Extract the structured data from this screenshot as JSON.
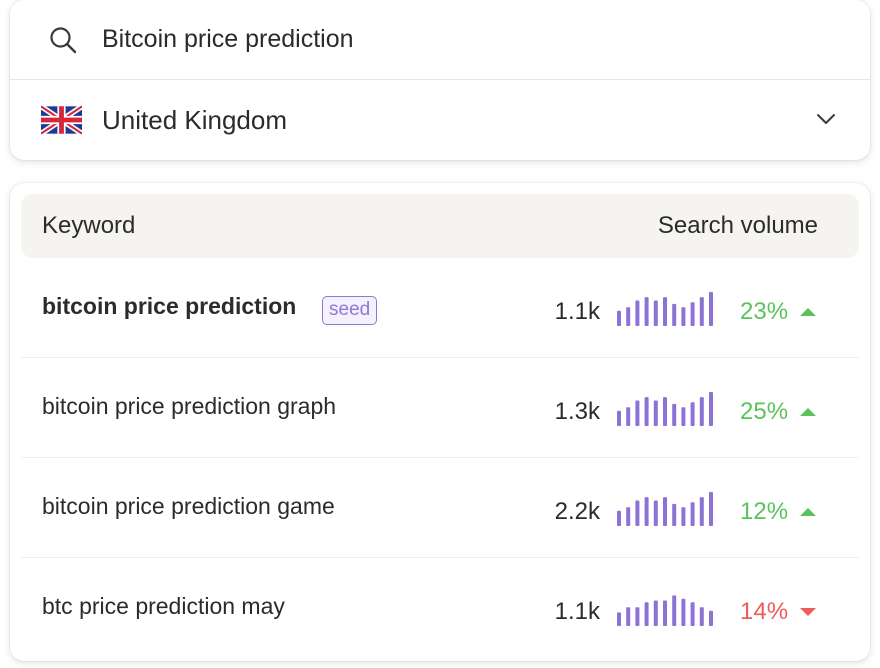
{
  "search": {
    "query": "Bitcoin price prediction",
    "icon": "search-icon"
  },
  "country": {
    "name": "United Kingdom",
    "flag": "uk-flag-icon",
    "icon": "chevron-down-icon"
  },
  "table": {
    "headers": {
      "keyword": "Keyword",
      "volume": "Search volume"
    },
    "rows": [
      {
        "keyword": "bitcoin price prediction",
        "seed": "seed",
        "volume": "1.1k",
        "change": "23%",
        "direction": "up",
        "trend": [
          0.45,
          0.55,
          0.75,
          0.85,
          0.75,
          0.85,
          0.65,
          0.55,
          0.7,
          0.85,
          1.0
        ]
      },
      {
        "keyword": "bitcoin price prediction graph",
        "volume": "1.3k",
        "change": "25%",
        "direction": "up",
        "trend": [
          0.45,
          0.55,
          0.75,
          0.85,
          0.75,
          0.85,
          0.65,
          0.55,
          0.7,
          0.85,
          1.0
        ]
      },
      {
        "keyword": "bitcoin price prediction game",
        "volume": "2.2k",
        "change": "12%",
        "direction": "up",
        "trend": [
          0.45,
          0.55,
          0.75,
          0.85,
          0.75,
          0.85,
          0.65,
          0.55,
          0.7,
          0.85,
          1.0
        ]
      },
      {
        "keyword": "btc price prediction may",
        "volume": "1.1k",
        "change": "14%",
        "direction": "down",
        "trend": [
          0.4,
          0.55,
          0.55,
          0.7,
          0.75,
          0.75,
          0.9,
          0.8,
          0.7,
          0.55,
          0.45
        ]
      }
    ]
  },
  "colors": {
    "spark": "#8c72d4",
    "up": "#5cc25c",
    "down": "#ef5a5a",
    "header_bg": "#f6f4f0"
  }
}
